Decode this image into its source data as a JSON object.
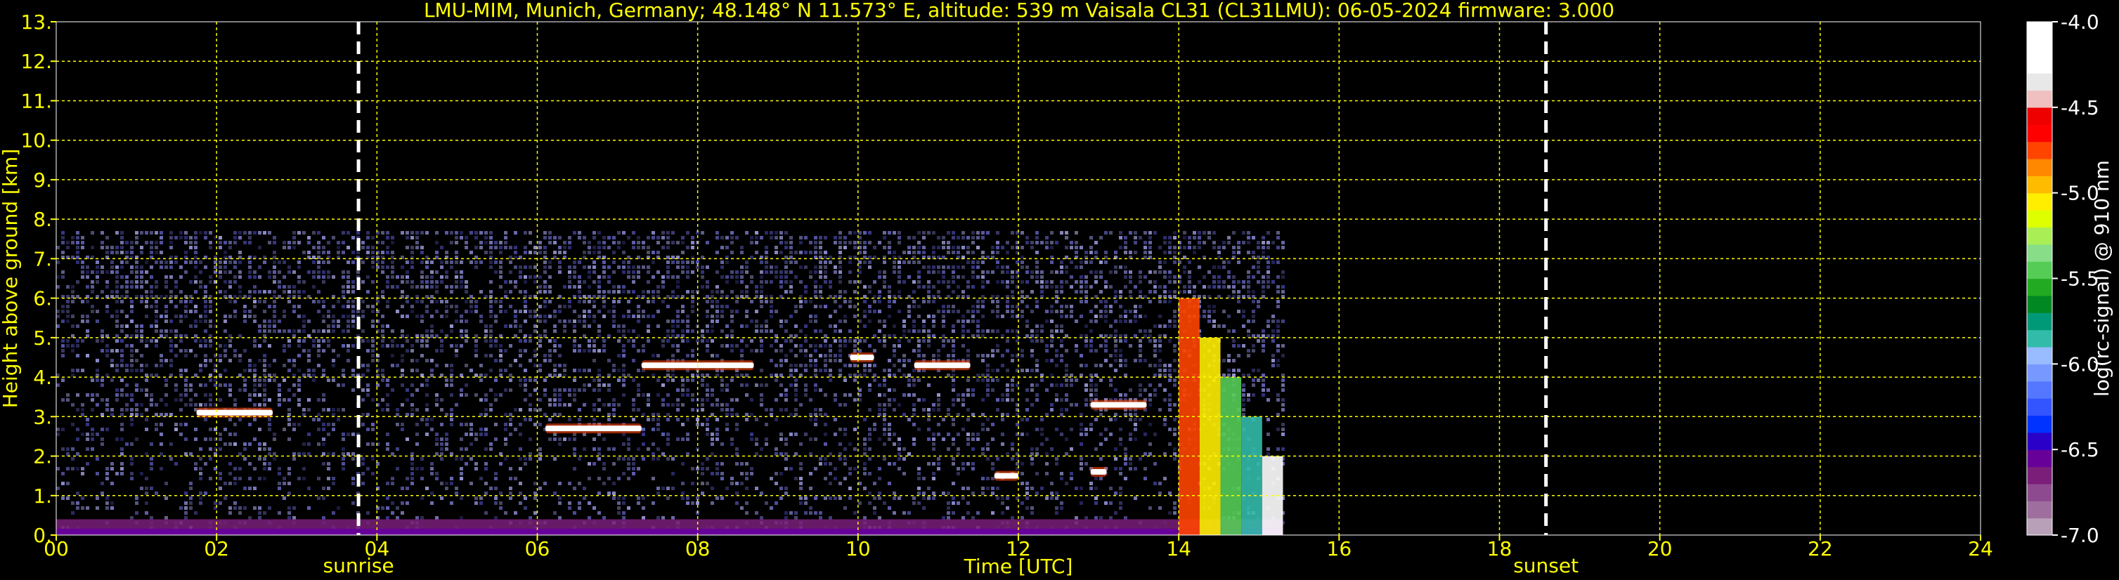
{
  "title": "LMU-MIM, Munich, Germany; 48.148° N 11.573° E, altitude: 539 m    Vaisala CL31 (CL31LMU): 06-05-2024    firmware: 3.000",
  "colors": {
    "background": "#000000",
    "axis_text": "#ffff00",
    "grid": "#ffff00",
    "colorbar_text": "#ffffff",
    "markers": "#ffffff"
  },
  "chart_data": {
    "type": "heatmap",
    "title": "LMU-MIM, Munich, Germany; 48.148° N 11.573° E, altitude: 539 m    Vaisala CL31 (CL31LMU): 06-05-2024    firmware: 3.000",
    "xlabel": "Time [UTC]",
    "ylabel": "Height above ground [km]",
    "xlim": [
      0,
      24
    ],
    "ylim": [
      0,
      13
    ],
    "x_ticks": [
      "00",
      "02",
      "04",
      "06",
      "08",
      "10",
      "12",
      "14",
      "16",
      "18",
      "20",
      "22",
      "24"
    ],
    "x_tick_values": [
      0,
      2,
      4,
      6,
      8,
      10,
      12,
      14,
      16,
      18,
      20,
      22,
      24
    ],
    "y_ticks": [
      "0.",
      "1.",
      "2.",
      "3.",
      "4.",
      "5.",
      "6.",
      "7.",
      "8.",
      "9.",
      "10.",
      "11.",
      "12.",
      "13."
    ],
    "y_tick_values": [
      0,
      1,
      2,
      3,
      4,
      5,
      6,
      7,
      8,
      9,
      10,
      11,
      12,
      13
    ],
    "grid": true,
    "data_extent": {
      "time_start": 0.0,
      "time_end": 15.3,
      "height_max": 7.7
    },
    "annotations": [
      {
        "label": "sunrise",
        "time": 3.77
      },
      {
        "label": "sunset",
        "time": 18.58
      }
    ],
    "features": [
      {
        "type": "surface_layer",
        "time_start": 0.0,
        "time_end": 15.3,
        "height_top": 0.4
      },
      {
        "type": "cloud_layer",
        "time_start": 1.75,
        "time_end": 2.7,
        "height": 3.1
      },
      {
        "type": "cloud_layer",
        "time_start": 6.1,
        "time_end": 7.3,
        "height": 2.7
      },
      {
        "type": "cloud_layer",
        "time_start": 7.3,
        "time_end": 8.7,
        "height": 4.3
      },
      {
        "type": "cloud_layer",
        "time_start": 9.9,
        "time_end": 10.2,
        "height": 4.5
      },
      {
        "type": "cloud_layer",
        "time_start": 10.7,
        "time_end": 11.4,
        "height": 4.3
      },
      {
        "type": "cloud_layer",
        "time_start": 12.9,
        "time_end": 13.6,
        "height": 3.3
      },
      {
        "type": "cloud_layer",
        "time_start": 11.7,
        "time_end": 12.0,
        "height": 1.5
      },
      {
        "type": "cloud_layer",
        "time_start": 12.9,
        "time_end": 13.1,
        "height": 1.6
      },
      {
        "type": "precipitation",
        "time_start": 14.0,
        "time_end": 15.3,
        "height_top": 6.0
      }
    ],
    "colorbar": {
      "label": "log(rc-signal) @ 910 nm",
      "range": [
        -7.0,
        -4.0
      ],
      "tick_labels": [
        "-4.0",
        "-4.5",
        "-5.0",
        "-5.5",
        "-6.0",
        "-6.5",
        "-7.0"
      ],
      "tick_values": [
        -4.0,
        -4.5,
        -5.0,
        -5.5,
        -6.0,
        -6.5,
        -7.0
      ],
      "colors": [
        "#b8a0b8",
        "#9e6e9e",
        "#8e4a8e",
        "#7a1e7a",
        "#660099",
        "#2a00c8",
        "#0033ff",
        "#3355ff",
        "#5577ff",
        "#7799ff",
        "#99bbff",
        "#33bbaa",
        "#009977",
        "#008822",
        "#22aa22",
        "#55cc55",
        "#88dd88",
        "#aaee55",
        "#ddff00",
        "#ffee00",
        "#ffbb00",
        "#ff8800",
        "#ff4400",
        "#ff0000",
        "#ee0000",
        "#f0c0c0",
        "#e8e8e8",
        "#ffffff",
        "#ffffff",
        "#ffffff"
      ]
    }
  }
}
